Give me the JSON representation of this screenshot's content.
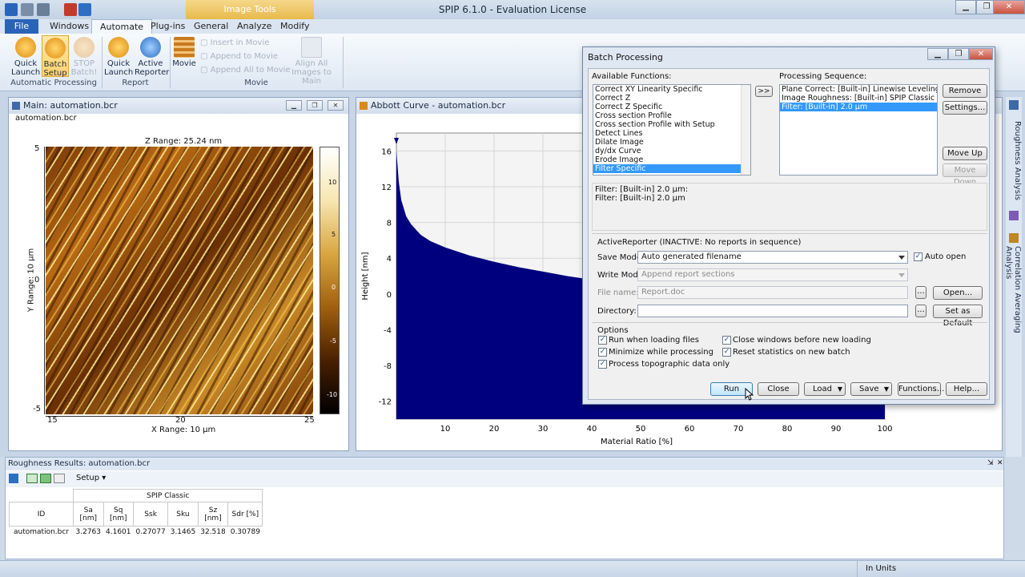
{
  "app_title": "SPIP 6.1.0 - Evaluation License",
  "context_tab": "Image Tools",
  "ribbon_tabs": [
    "File",
    "Windows",
    "Automate",
    "Plug-ins",
    "General",
    "Analyze",
    "Modify"
  ],
  "ribbon": {
    "quick_launch": "Quick Launch",
    "batch_setup": "Batch Setup",
    "stop_batch": "STOP Batch!",
    "quick_launch2": "Quick Launch",
    "active_reporter": "Active Reporter",
    "movie": "Movie",
    "insert_in_movie": "Insert in Movie",
    "append_to_movie": "Append to Movie",
    "append_all_to_movie": "Append All to Movie",
    "align_all": "Align All Images to Main",
    "groups": [
      "Automatic Processing",
      "Report",
      "Movie"
    ]
  },
  "main_window": {
    "title": "Main: automation.bcr",
    "filename": "automation.bcr",
    "z_range": "Z Range:  25.24 nm",
    "y_label": "Y Range: 10 µm",
    "x_label": "X Range: 10 µm",
    "x_ticks": [
      "15",
      "20",
      "25"
    ],
    "y_ticks": [
      "5",
      "0",
      "-5"
    ],
    "colorbar_ticks": [
      "10",
      "5",
      "0",
      "-5",
      "-10"
    ]
  },
  "abbott_window": {
    "title": "Abbott Curve - automation.bcr"
  },
  "chart_data": {
    "type": "area",
    "xlabel": "Material Ratio [%]",
    "ylabel": "Height [nm]",
    "xlim": [
      0,
      100
    ],
    "ylim": [
      -14,
      18
    ],
    "x_ticks": [
      10,
      20,
      30,
      40,
      50,
      60,
      70,
      80,
      90,
      100
    ],
    "y_ticks": [
      16,
      12,
      8,
      4,
      0,
      -4,
      -8,
      -12
    ],
    "grid": true,
    "x": [
      0,
      0.5,
      1,
      2,
      3,
      5,
      7,
      10,
      15,
      20,
      25,
      30,
      35,
      40,
      45,
      50,
      55,
      60,
      65,
      70,
      75,
      80,
      85,
      90,
      95,
      98,
      99,
      100
    ],
    "y": [
      16,
      12.5,
      10.5,
      8.7,
      7.8,
      6.6,
      5.9,
      5.2,
      4.3,
      3.6,
      3.0,
      2.5,
      2.0,
      1.6,
      1.1,
      0.7,
      0.3,
      -0.1,
      -0.5,
      -0.9,
      -1.4,
      -1.9,
      -2.5,
      -3.3,
      -4.6,
      -6.0,
      -7.5,
      -10.0
    ],
    "color": "#00007f"
  },
  "dialog": {
    "title": "Batch Processing",
    "available_label": "Available Functions:",
    "available": [
      "Correct XY Linearity Specific",
      "Correct Z",
      "Correct Z Specific",
      "Cross section Profile",
      "Cross section Profile with Setup",
      "Detect Lines",
      "Dilate Image",
      "dy/dx Curve",
      "Erode Image",
      "Filter Specific"
    ],
    "selected_available": "Filter Specific",
    "add_button": ">>",
    "sequence_label": "Processing Sequence:",
    "sequence": [
      "Plane Correct: [Built-in] Linewise Leveling",
      "Image Roughness: [Built-in] SPIP Classic Default",
      "Filter: [Built-in] 2.0 µm"
    ],
    "remove": "Remove",
    "settings": "Settings...",
    "move_up": "Move Up",
    "move_down": "Move Down",
    "desc_line1": "Filter: [Built-in] 2.0 µm:",
    "desc_line2": "Filter: [Built-in] 2.0 µm",
    "active_reporter": "ActiveReporter (INACTIVE: No reports in sequence)",
    "save_mode_label": "Save Mode:",
    "save_mode": "Auto generated filename",
    "auto_open": "Auto open",
    "write_mode_label": "Write Mode:",
    "write_mode": "Append report sections",
    "file_name_label": "File name:",
    "file_name": "Report.doc",
    "open": "Open...",
    "directory_label": "Directory:",
    "directory": "",
    "browse": "...",
    "set_default": "Set as Default",
    "options_label": "Options",
    "opt_run_loading": "Run when loading files",
    "opt_minimize": "Minimize while processing",
    "opt_topographic": "Process topographic data only",
    "opt_close_windows": "Close windows before new loading",
    "opt_reset": "Reset statistics on new batch",
    "run": "Run",
    "close": "Close",
    "load": "Load",
    "save": "Save",
    "functions": "Functions...",
    "help": "Help..."
  },
  "side_tabs": [
    "Roughness Analysis",
    "Correlation Averaging Analysis"
  ],
  "roughness": {
    "title": "Roughness Results: automation.bcr",
    "setup": "Setup",
    "group_header": "SPIP Classic",
    "headers": [
      "ID",
      "Sa [nm]",
      "Sq [nm]",
      "Ssk",
      "Sku",
      "Sz [nm]",
      "Sdr [%]"
    ],
    "row": [
      "automation.bcr",
      "3.2763",
      "4.1601",
      "0.27077",
      "3.1465",
      "32.518",
      "0.30789"
    ]
  },
  "status": {
    "units": "In Units"
  }
}
